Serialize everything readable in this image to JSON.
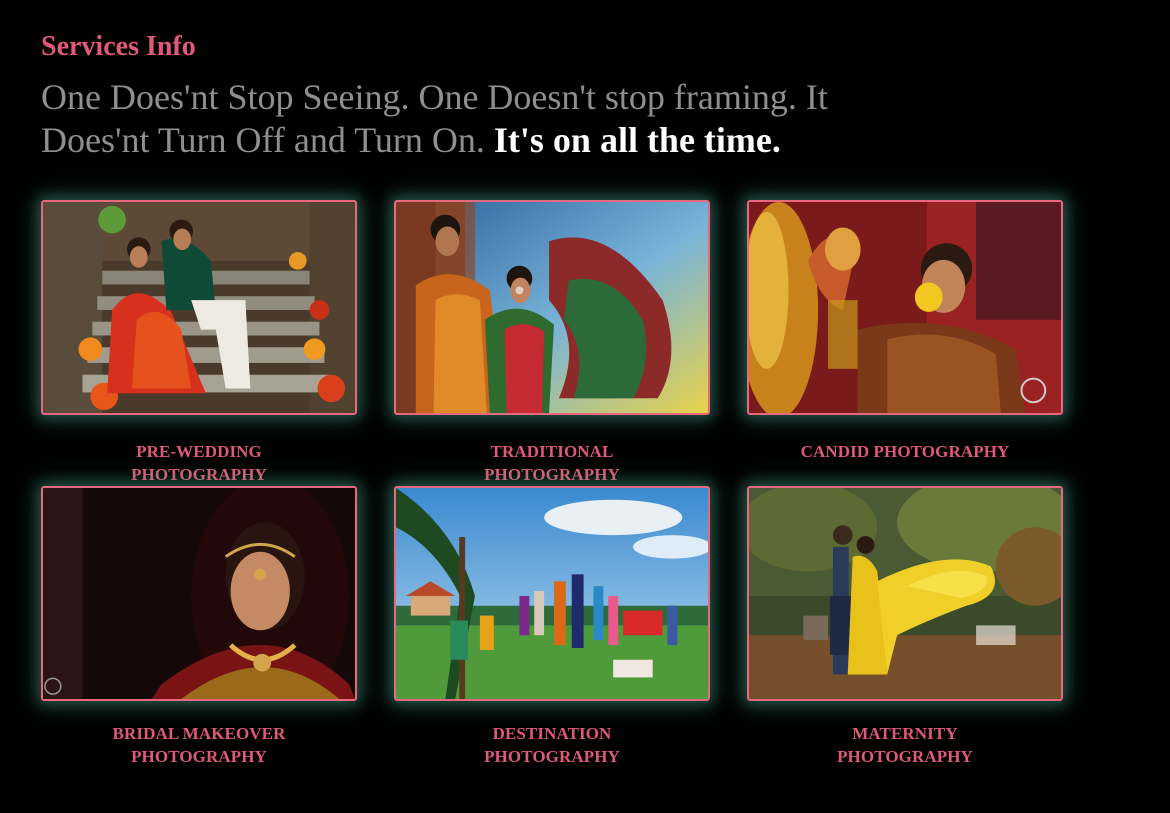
{
  "colors": {
    "accent": "#e05a78",
    "background": "#000000",
    "tagline_muted": "#8f8f8f",
    "tagline_emphasis": "#ffffff",
    "frame_border": "#e9687f",
    "frame_glow": "#5ac8aa"
  },
  "header": {
    "section_label": "Services Info",
    "tagline_part1": "One Does'nt Stop Seeing. One Doesn't stop framing. It Does'nt Turn Off and Turn On.",
    "tagline_emphasis": "It's on all the time."
  },
  "services": [
    {
      "title": "PRE-WEDDING PHOTOGRAPHY"
    },
    {
      "title": "TRADITIONAL PHOTOGRAPHY"
    },
    {
      "title": "CANDID PHOTOGRAPHY"
    },
    {
      "title": "BRIDAL MAKEOVER PHOTOGRAPHY"
    },
    {
      "title": "DESTINATION PHOTOGRAPHY"
    },
    {
      "title": "MATERNITY PHOTOGRAPHY"
    }
  ]
}
